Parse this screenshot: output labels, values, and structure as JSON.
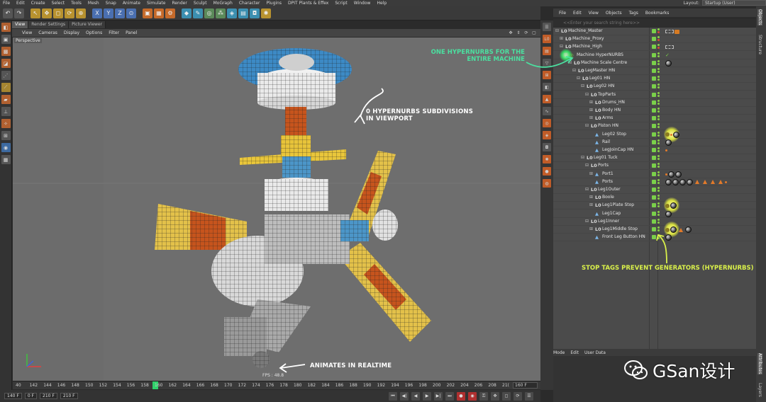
{
  "menubar": {
    "items": [
      "File",
      "Edit",
      "Create",
      "Select",
      "Tools",
      "Mesh",
      "Snap",
      "Animate",
      "Simulate",
      "Render",
      "Sculpt",
      "MoGraph",
      "Character",
      "Plugins",
      "DPIT Plants & Effex",
      "Script",
      "Window",
      "Help"
    ],
    "layout_label": "Layout:",
    "layout_value": "Startup (User)"
  },
  "viewport_tabs": [
    "View",
    "Render Settings",
    "Picture Viewer"
  ],
  "viewport_menu": [
    "View",
    "Cameras",
    "Display",
    "Options",
    "Filter",
    "Panel"
  ],
  "viewport": {
    "label": "Perspective",
    "fps": "FPS : 48.8"
  },
  "annotations": {
    "subdivisions": "0 Hypernurbs subdivisions in viewport",
    "realtime": "Animates in realtime",
    "one_hn": "One HyperNURBS for the entire machine",
    "stop_tags": "Stop tags prevent generators (HyperNURBS)"
  },
  "timeline": {
    "ticks": [
      "40",
      "142",
      "144",
      "146",
      "148",
      "150",
      "152",
      "154",
      "156",
      "158",
      "160",
      "162",
      "164",
      "166",
      "168",
      "170",
      "172",
      "174",
      "176",
      "178",
      "180",
      "182",
      "184",
      "186",
      "188",
      "190",
      "192",
      "194",
      "196",
      "198",
      "200",
      "202",
      "204",
      "206",
      "208",
      "21("
    ],
    "current": "160",
    "end_frame": "160 F"
  },
  "bottombar": {
    "start": "140 F",
    "current": "0 F",
    "end": "210 F",
    "max": "210 F"
  },
  "object_manager": {
    "menu": [
      "File",
      "Edit",
      "View",
      "Objects",
      "Tags",
      "Bookmarks"
    ],
    "search_placeholder": "<<Enter your search string here>>",
    "rows": [
      {
        "name": "Machine_Master",
        "depth": 0,
        "exp": "⊟",
        "icon": "L0"
      },
      {
        "name": "Machine_Proxy",
        "depth": 1,
        "exp": "⊞",
        "icon": "L0"
      },
      {
        "name": "Machine_High",
        "depth": 1,
        "exp": "⊟",
        "icon": "L0"
      },
      {
        "name": "Machine HyperNURBS",
        "depth": 2,
        "exp": "⊟",
        "icon": "HN"
      },
      {
        "name": "Machine Scale Centre",
        "depth": 3,
        "exp": "⊟",
        "icon": "L0"
      },
      {
        "name": "LegMaster HN",
        "depth": 4,
        "exp": "⊟",
        "icon": "L0"
      },
      {
        "name": "Leg01 HN",
        "depth": 5,
        "exp": "⊟",
        "icon": "L0"
      },
      {
        "name": "Leg02 HN",
        "depth": 6,
        "exp": "⊟",
        "icon": "L0"
      },
      {
        "name": "TopParts",
        "depth": 7,
        "exp": "⊟",
        "icon": "L0"
      },
      {
        "name": "Drums_HN",
        "depth": 8,
        "exp": "⊞",
        "icon": "L0"
      },
      {
        "name": "Body HN",
        "depth": 8,
        "exp": "⊞",
        "icon": "L0"
      },
      {
        "name": "Arms",
        "depth": 8,
        "exp": "⊞",
        "icon": "L0"
      },
      {
        "name": "Piston HN",
        "depth": 7,
        "exp": "⊟",
        "icon": "L0"
      },
      {
        "name": "Leg02 Stop",
        "depth": 8,
        "exp": "",
        "icon": "▲"
      },
      {
        "name": "Rail",
        "depth": 8,
        "exp": "",
        "icon": "▲"
      },
      {
        "name": "LegJoinCap HN",
        "depth": 8,
        "exp": "",
        "icon": "▲"
      },
      {
        "name": "Leg01 Tuck",
        "depth": 6,
        "exp": "⊟",
        "icon": "L0"
      },
      {
        "name": "Ports",
        "depth": 7,
        "exp": "⊟",
        "icon": "L0"
      },
      {
        "name": "Port1",
        "depth": 8,
        "exp": "⊞",
        "icon": "▲"
      },
      {
        "name": "Ports",
        "depth": 8,
        "exp": "",
        "icon": "▲"
      },
      {
        "name": "Leg1Outer",
        "depth": 7,
        "exp": "⊟",
        "icon": "L0"
      },
      {
        "name": "Boole",
        "depth": 8,
        "exp": "⊞",
        "icon": "L0"
      },
      {
        "name": "Leg1Plate Stop",
        "depth": 8,
        "exp": "⊞",
        "icon": "L0"
      },
      {
        "name": "Leg1Cap",
        "depth": 8,
        "exp": "",
        "icon": "▲"
      },
      {
        "name": "Leg1Inner",
        "depth": 7,
        "exp": "⊟",
        "icon": "L0"
      },
      {
        "name": "Leg1Middle Stop",
        "depth": 8,
        "exp": "⊞",
        "icon": "L0"
      },
      {
        "name": "Front Leg Button HN",
        "depth": 8,
        "exp": "",
        "icon": "▲"
      }
    ]
  },
  "attribute_manager": {
    "menu": [
      "Mode",
      "Edit",
      "User Data"
    ]
  },
  "right_tabs": [
    "Objects",
    "Structure",
    "Attributes",
    "Layers"
  ],
  "watermark": {
    "text": "GSan设计"
  },
  "colors": {
    "hn_annotation": "#4be0a0",
    "stop_annotation": "#d9f04a",
    "timeline_cursor": "#2fd06a",
    "enabled_check": "#7ad04a"
  }
}
